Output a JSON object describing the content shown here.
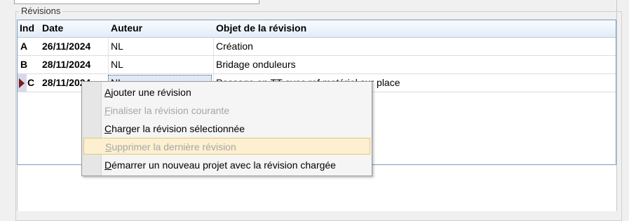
{
  "group": {
    "title": "Révisions"
  },
  "grid": {
    "headers": [
      "Ind",
      "Date",
      "Auteur",
      "Objet de la révision"
    ],
    "rows": [
      {
        "ind": "A",
        "date": "26/11/2024",
        "author": "NL",
        "object": "Création"
      },
      {
        "ind": "B",
        "date": "28/11/2024",
        "author": "NL",
        "object": "Bridage onduleurs"
      },
      {
        "ind": "C",
        "date": "28/11/2024",
        "author": "NL",
        "object": "Passage en TT avec ref matériel sur place"
      }
    ]
  },
  "menu": {
    "items": [
      {
        "key": "A",
        "rest": "jouter une révision",
        "enabled": true
      },
      {
        "key": "F",
        "rest": "inaliser la révision courante",
        "enabled": false
      },
      {
        "key": "C",
        "rest": "harger la révision sélectionnée",
        "enabled": true
      },
      {
        "key": "S",
        "rest": "upprimer la dernière révision",
        "enabled": false
      },
      {
        "key": "D",
        "rest": "émarrer un nouveau projet avec la révision chargée",
        "enabled": true
      }
    ]
  },
  "colors": {
    "header_bg": "#e3edf7",
    "grid_border": "#7a9cc0",
    "menu_highlight": "#fcf0d0",
    "disabled_text": "#a6a6a6"
  }
}
